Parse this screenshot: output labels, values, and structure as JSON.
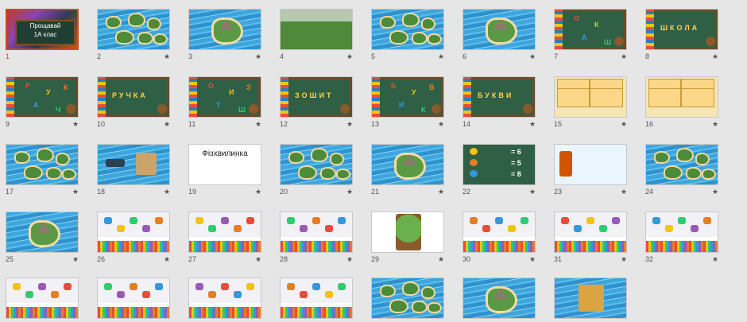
{
  "slides": [
    {
      "num": "1",
      "star": "",
      "theme": "title",
      "selected": true,
      "title_line1": "Прощавай",
      "title_line2": "1А клас"
    },
    {
      "num": "2",
      "star": "★",
      "theme": "islands"
    },
    {
      "num": "3",
      "star": "★",
      "theme": "big-island"
    },
    {
      "num": "4",
      "star": "★",
      "theme": "landscape"
    },
    {
      "num": "5",
      "star": "★",
      "theme": "islands"
    },
    {
      "num": "6",
      "star": "★",
      "theme": "big-island"
    },
    {
      "num": "7",
      "star": "★",
      "theme": "letters",
      "letters": [
        "О",
        "К",
        "А",
        "Ш"
      ]
    },
    {
      "num": "8",
      "star": "★",
      "theme": "word",
      "word": "ШКОЛА"
    },
    {
      "num": "9",
      "star": "★",
      "theme": "letters",
      "letters": [
        "Р",
        "У",
        "А",
        "Ч",
        "К"
      ]
    },
    {
      "num": "10",
      "star": "★",
      "theme": "word",
      "word": "РУЧКА"
    },
    {
      "num": "11",
      "star": "★",
      "theme": "letters",
      "letters": [
        "О",
        "И",
        "Т",
        "Ш",
        "З"
      ]
    },
    {
      "num": "12",
      "star": "★",
      "theme": "word",
      "word": "ЗОШИТ"
    },
    {
      "num": "13",
      "star": "★",
      "theme": "letters",
      "letters": [
        "Б",
        "У",
        "И",
        "К",
        "В"
      ]
    },
    {
      "num": "14",
      "star": "★",
      "theme": "word",
      "word": "БУКВИ"
    },
    {
      "num": "15",
      "star": "★",
      "theme": "puzzle"
    },
    {
      "num": "16",
      "star": "★",
      "theme": "puzzle"
    },
    {
      "num": "17",
      "star": "★",
      "theme": "islands"
    },
    {
      "num": "18",
      "star": "★",
      "theme": "ship"
    },
    {
      "num": "19",
      "star": "★",
      "theme": "text",
      "title": "Фізхвилинка"
    },
    {
      "num": "20",
      "star": "★",
      "theme": "islands"
    },
    {
      "num": "21",
      "star": "★",
      "theme": "big-island"
    },
    {
      "num": "22",
      "star": "★",
      "theme": "math",
      "eq1": "= 6",
      "eq2": "= 5",
      "eq3": "= 8"
    },
    {
      "num": "23",
      "star": "★",
      "theme": "forest"
    },
    {
      "num": "24",
      "star": "★",
      "theme": "islands"
    },
    {
      "num": "25",
      "star": "★",
      "theme": "big-island"
    },
    {
      "num": "26",
      "star": "★",
      "theme": "objects"
    },
    {
      "num": "27",
      "star": "★",
      "theme": "objects"
    },
    {
      "num": "28",
      "star": "★",
      "theme": "objects"
    },
    {
      "num": "29",
      "star": "★",
      "theme": "tree"
    },
    {
      "num": "30",
      "star": "★",
      "theme": "objects"
    },
    {
      "num": "31",
      "star": "★",
      "theme": "objects"
    },
    {
      "num": "32",
      "star": "★",
      "theme": "objects"
    },
    {
      "num": "",
      "star": "",
      "theme": "objects"
    },
    {
      "num": "",
      "star": "",
      "theme": "objects"
    },
    {
      "num": "",
      "star": "",
      "theme": "objects"
    },
    {
      "num": "",
      "star": "",
      "theme": "objects"
    },
    {
      "num": "",
      "star": "",
      "theme": "islands"
    },
    {
      "num": "",
      "star": "",
      "theme": "big-island"
    },
    {
      "num": "",
      "star": "",
      "theme": "chest"
    }
  ],
  "colors": {
    "selection": "#d24726",
    "background": "#e6e6e6"
  },
  "icons": {
    "star": "star-icon"
  }
}
